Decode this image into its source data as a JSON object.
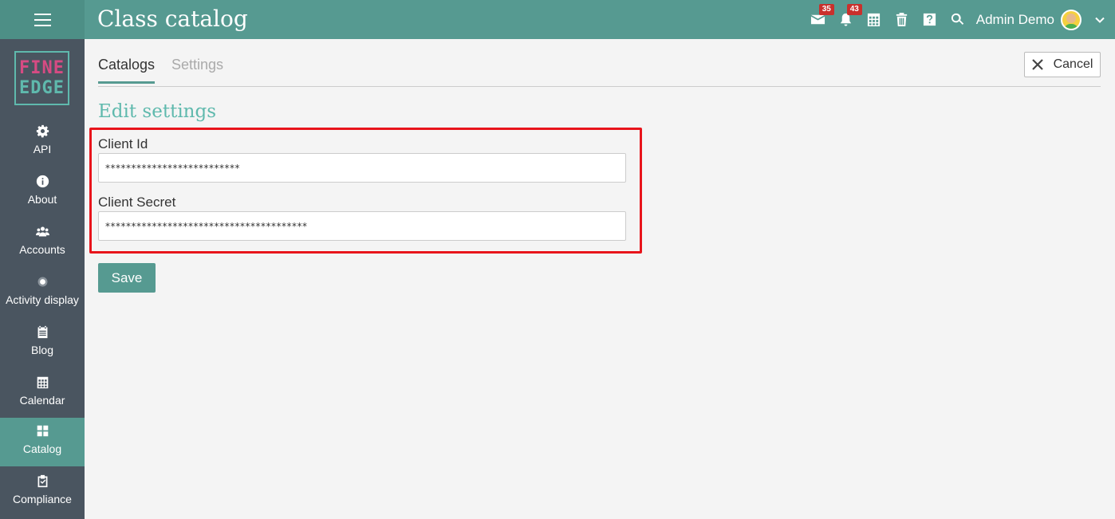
{
  "header": {
    "title": "Class catalog",
    "messages_badge": "35",
    "notifications_badge": "43",
    "user_name": "Admin Demo",
    "icons": [
      "menu-icon",
      "envelope-icon",
      "bell-icon",
      "calendar-icon",
      "trash-icon",
      "help-icon",
      "search-icon",
      "chevron-down-icon"
    ]
  },
  "logo": {
    "line1": "FINE",
    "line2": "EDGE"
  },
  "sidebar": {
    "items": [
      {
        "label": "API",
        "icon": "gear-icon"
      },
      {
        "label": "About",
        "icon": "info-icon"
      },
      {
        "label": "Accounts",
        "icon": "users-icon"
      },
      {
        "label": "Activity display",
        "icon": "dot-circle-icon"
      },
      {
        "label": "Blog",
        "icon": "blog-icon"
      },
      {
        "label": "Calendar",
        "icon": "calendar-icon"
      },
      {
        "label": "Catalog",
        "icon": "grid-icon",
        "active": true
      },
      {
        "label": "Compliance",
        "icon": "clipboard-check-icon"
      }
    ]
  },
  "tabs": [
    {
      "label": "Catalogs",
      "active": true
    },
    {
      "label": "Settings",
      "active": false
    }
  ],
  "cancel_label": "Cancel",
  "form": {
    "title": "Edit settings",
    "client_id_label": "Client Id",
    "client_id_value": "**************************",
    "client_secret_label": "Client Secret",
    "client_secret_value": "***************************************",
    "save_label": "Save"
  },
  "colors": {
    "topbar": "#569a91",
    "sidebar": "#4a5560",
    "accent": "#5fb9ad",
    "highlight": "#e8141b",
    "badge": "#c9302c"
  }
}
